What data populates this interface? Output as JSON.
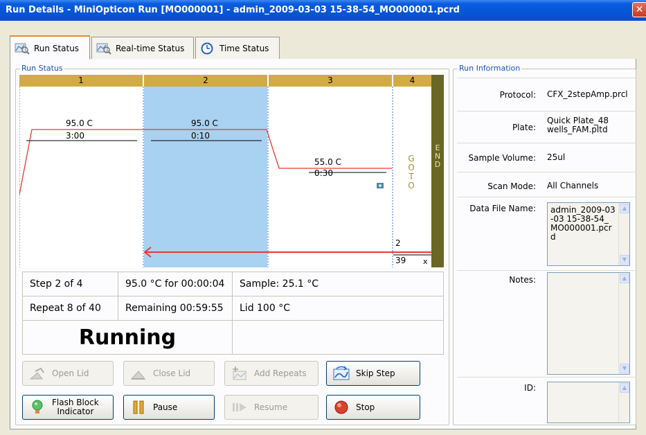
{
  "window": {
    "title": "Run Details - MiniOpticon Run [MO000001] - admin_2009-03-03 15-38-54_MO000001.pcrd",
    "close_glyph": "✕"
  },
  "tabs": [
    {
      "label": "Run Status",
      "icon": "magnifier-chart-icon"
    },
    {
      "label": "Real-time Status",
      "icon": "magnifier-chart-icon"
    },
    {
      "label": "Time Status",
      "icon": "clock-icon"
    }
  ],
  "run_status": {
    "group_title": "Run Status",
    "steps": [
      "1",
      "2",
      "3",
      "4"
    ],
    "end_letters": [
      "E",
      "N",
      "D"
    ],
    "goto_letters": [
      "G",
      "O",
      "T",
      "O"
    ],
    "step1": {
      "temp": "95.0  C",
      "time": "3:00"
    },
    "step2": {
      "temp": "95.0  C",
      "time": "0:10"
    },
    "step3": {
      "temp": "55.0  C",
      "time": "0:30"
    },
    "goto_target": "2",
    "goto_count": "39",
    "goto_x": "x",
    "current_step": 2
  },
  "status_info": {
    "step": "Step 2 of 4",
    "target": "95.0 °C for 00:00:04",
    "sample": "Sample: 25.1 °C",
    "repeat": "Repeat 8 of 40",
    "remaining": "Remaining 00:59:55",
    "lid": "Lid 100 °C",
    "state": "Running"
  },
  "buttons": {
    "open_lid": "Open Lid",
    "close_lid": "Close Lid",
    "add_repeats": "Add Repeats",
    "skip_step": "Skip Step",
    "flash_block": "Flash Block Indicator",
    "flash_block_line1": "Flash Block",
    "flash_block_line2": "Indicator",
    "pause": "Pause",
    "resume": "Resume",
    "stop": "Stop"
  },
  "run_information": {
    "group_title": "Run Information",
    "protocol_label": "Protocol:",
    "protocol_value": "CFX_2stepAmp.prcl",
    "plate_label": "Plate:",
    "plate_value": "Quick Plate_48 wells_FAM.pltd",
    "sample_volume_label": "Sample Volume:",
    "sample_volume_value": "25ul",
    "scan_mode_label": "Scan Mode:",
    "scan_mode_value": "All Channels",
    "data_file_label": "Data File Name:",
    "data_file_value": "admin_2009-03-03 15-38-54_MO000001.pcrd",
    "notes_label": "Notes:",
    "notes_value": "",
    "id_label": "ID:",
    "id_value": ""
  },
  "colors": {
    "step_header": "#d2ab44",
    "current_step_bg": "#a9d1f1",
    "end_bar": "#6a6623",
    "temp_line": "#e8392c",
    "titlebar": "#0555d6"
  }
}
